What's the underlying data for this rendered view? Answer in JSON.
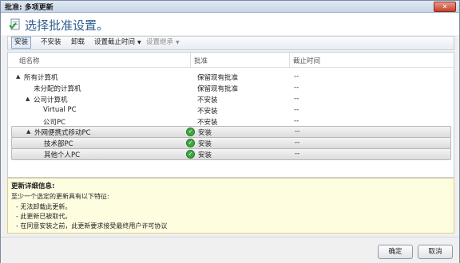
{
  "window": {
    "title": "批准: 多项更新",
    "close_label": "✕"
  },
  "header": {
    "title": "选择批准设置。"
  },
  "toolbar": {
    "items": [
      {
        "label": "安装",
        "selected": true,
        "disabled": false,
        "dropdown": false
      },
      {
        "label": "不安装",
        "selected": false,
        "disabled": false,
        "dropdown": false
      },
      {
        "label": "卸载",
        "selected": false,
        "disabled": false,
        "dropdown": false
      },
      {
        "label": "设置截止时间",
        "selected": false,
        "disabled": false,
        "dropdown": true
      },
      {
        "label": "设置继承",
        "selected": false,
        "disabled": true,
        "dropdown": true
      }
    ]
  },
  "grid": {
    "columns": {
      "group": "组名称",
      "approval": "批准",
      "deadline": "截止时间"
    },
    "rows": [
      {
        "name": "所有计算机",
        "expander": "▲",
        "approval": "保留现有批准",
        "deadline": "--",
        "highlight": false,
        "icon": ""
      },
      {
        "name": "未分配的计算机",
        "expander": "",
        "approval": "保留现有批准",
        "deadline": "--",
        "highlight": false,
        "icon": ""
      },
      {
        "name": "公司计算机",
        "expander": "▲",
        "approval": "不安装",
        "deadline": "--",
        "highlight": false,
        "icon": ""
      },
      {
        "name": "Virtual PC",
        "expander": "",
        "approval": "不安装",
        "deadline": "--",
        "highlight": false,
        "icon": ""
      },
      {
        "name": "公司PC",
        "expander": "",
        "approval": "不安装",
        "deadline": "--",
        "highlight": false,
        "icon": ""
      },
      {
        "name": "外网便携式移动PC",
        "expander": "▲",
        "approval": "安装",
        "deadline": "--",
        "highlight": true,
        "icon": "check-icon"
      },
      {
        "name": "技术部PC",
        "expander": "",
        "approval": "安装",
        "deadline": "--",
        "highlight": true,
        "icon": "check-icon"
      },
      {
        "name": "其他个人PC",
        "expander": "",
        "approval": "安装",
        "deadline": "--",
        "highlight": true,
        "icon": "check-icon"
      }
    ]
  },
  "info": {
    "title": "更新详细信息:",
    "intro": "至少一个选定的更新具有以下特征:",
    "bullets": [
      "- 无法卸载此更新。",
      "- 此更新已被取代。",
      "- 在同意安装之前，此更新要求接受最终用户许可协议"
    ]
  },
  "buttons": {
    "ok": "确定",
    "cancel": "取消"
  }
}
